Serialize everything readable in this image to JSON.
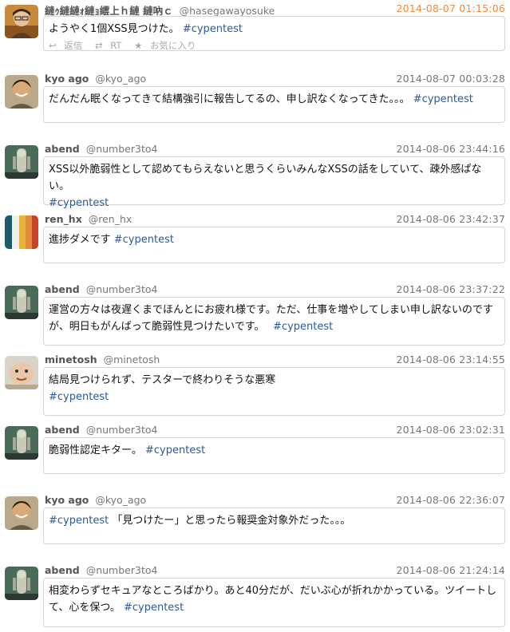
{
  "tweets": [
    {
      "name": "縺ｩ縺縺ｫ縺ｮ繧上ｈ縺 縺吶ｃ",
      "handle": "@hasegawayosuke",
      "time": "2014-08-07 01:15:06",
      "text": "ようやく1個XSS見つけた。",
      "tag": "#cypentest",
      "text_after": "",
      "actions": {
        "reply": "返信",
        "retweet": "RT",
        "favorite": "お気に入り"
      }
    },
    {
      "name": "kyo ago",
      "handle": "@kyo_ago",
      "time": "2014-08-07 00:03:28",
      "text": "だんだん眠くなってきて結構強引に報告してるの、申し訳なくなってきた。。。",
      "tag": "#cypentest",
      "text_after": ""
    },
    {
      "name": "abend",
      "handle": "@number3to4",
      "time": "2014-08-06 23:44:16",
      "text": "XSS以外脆弱性として認めてもらえないと思うくらいみんなXSSの話をしていて、疎外感ぱない。",
      "tag": "#cypentest",
      "text_after": ""
    },
    {
      "name": "ren_hx",
      "handle": "@ren_hx",
      "time": "2014-08-06 23:42:37",
      "text": "進捗ダメです",
      "tag": "#cypentest",
      "text_after": ""
    },
    {
      "name": "abend",
      "handle": "@number3to4",
      "time": "2014-08-06 23:37:22",
      "text": "運営の方々は夜遅くまでほんとにお疲れ様です。ただ、仕事を増やしてしまい申し訳ないのですが、明日もがんばって脆弱性見つけたいです。　",
      "tag": "#cypentest",
      "text_after": ""
    },
    {
      "name": "minetosh",
      "handle": "@minetosh",
      "time": "2014-08-06 23:14:55",
      "text": "結局見つけられず、テスターで終わりそうな悪寒",
      "tag": "#cypentest",
      "text_after": ""
    },
    {
      "name": "abend",
      "handle": "@number3to4",
      "time": "2014-08-06 23:02:31",
      "text": "脆弱性認定キター。",
      "tag": "#cypentest",
      "text_after": ""
    },
    {
      "name": "kyo ago",
      "handle": "@kyo_ago",
      "time": "2014-08-06 22:36:07",
      "text": "",
      "tag": "#cypentest",
      "text_after": "「見つけたー」と思ったら報奨金対象外だった。。。"
    },
    {
      "name": "abend",
      "handle": "@number3to4",
      "time": "2014-08-06 21:24:14",
      "text": "相変わらずセキュアなところばかり。あと40分だが、だいぶ心が折れかかっている。ツイートして、心を保つ。",
      "tag": "#cypentest",
      "text_after": ""
    }
  ]
}
